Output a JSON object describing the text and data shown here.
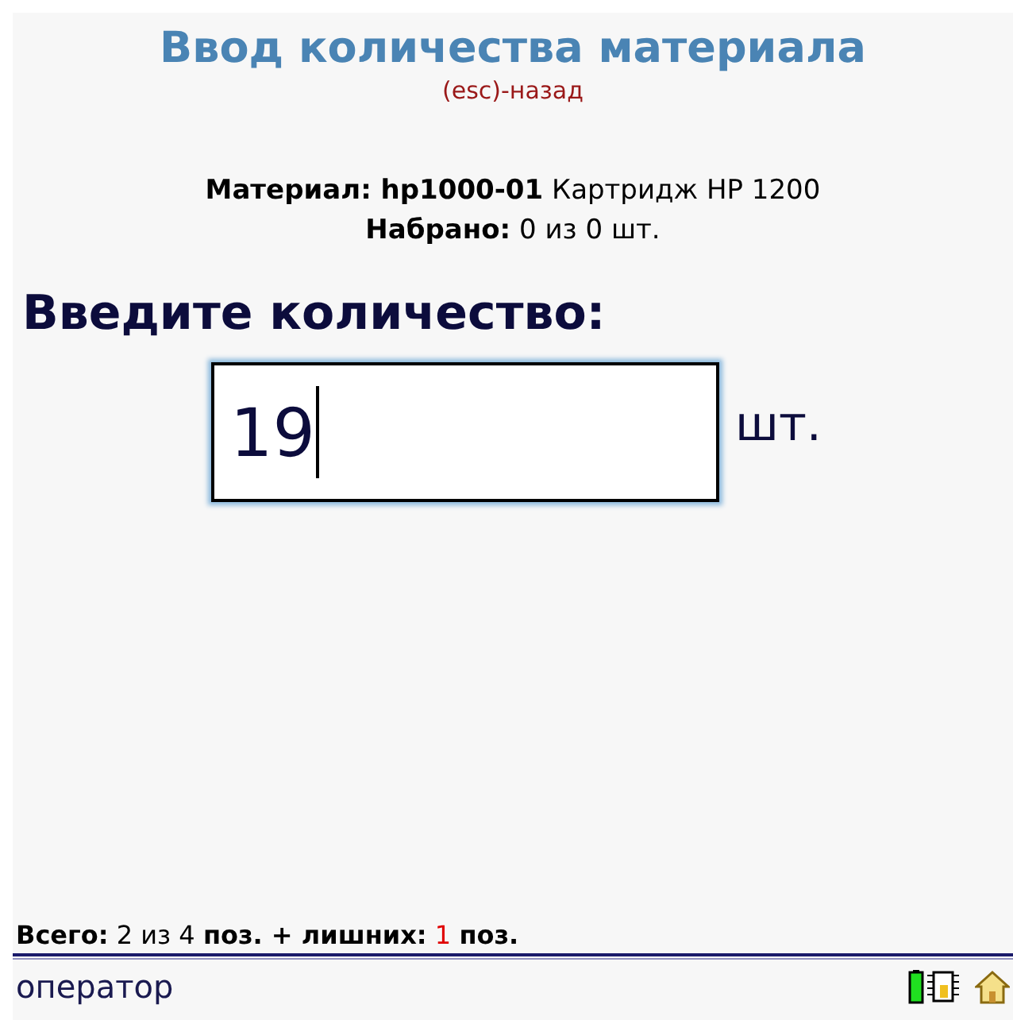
{
  "header": {
    "title": "Ввод количества материала",
    "back_hint": "(esc)-назад"
  },
  "info": [
    "**Материал: hp1000-01** Картридж HP 1200",
    "**Набрано:** 0 из 0 шт."
  ],
  "prompt": "Введите количество:",
  "quantity": {
    "value": "19",
    "unit": "шт."
  },
  "summary": [
    {
      "text": "Всего:",
      "kind": "label"
    },
    {
      "text": "2",
      "kind": "value"
    },
    {
      "text": "из",
      "kind": "value"
    },
    {
      "text": "4",
      "kind": "value"
    },
    {
      "text": "поз. + лишних:",
      "kind": "label"
    },
    {
      "text": "1",
      "kind": "alert"
    },
    {
      "text": "поз.",
      "kind": "label"
    }
  ],
  "status_bar": {
    "user": "оператор"
  }
}
